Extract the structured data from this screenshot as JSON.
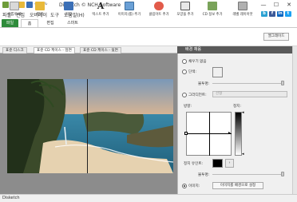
{
  "window": {
    "title": "Disketch © NCH Software",
    "minimize_glyph": "—",
    "maximize_glyph": "☐",
    "close_glyph": "✕"
  },
  "menubar": {
    "items": [
      "파일",
      "편집",
      "오버레이",
      "도구",
      "도움말(H)"
    ]
  },
  "social": [
    "b",
    "f",
    "in",
    "t"
  ],
  "ribbon_tabs": [
    "파일",
    "홈",
    "편집",
    "스마트"
  ],
  "toolbar": {
    "buttons": [
      {
        "label": "새롭게 새",
        "icon": "new-doc-icon",
        "color": "#d9d9d9"
      },
      {
        "label": "열기",
        "icon": "open-folder-icon",
        "color": "#e8b93a"
      },
      {
        "label": "저장",
        "icon": "save-icon",
        "color": "#3b6fb6"
      },
      {
        "label": "텍스트 추가",
        "icon": "text-icon",
        "color": "#ffffff"
      },
      {
        "label": "이미지(를) 추가",
        "icon": "add-image-icon",
        "color": "#6aa0d6"
      },
      {
        "label": "클립아트 추가",
        "icon": "clipart-icon",
        "color": "#e25b4a"
      },
      {
        "label": "모양을 추가",
        "icon": "shape-icon",
        "color": "#e8e8e8"
      },
      {
        "label": "CD 정보 추가",
        "icon": "cd-info-icon",
        "color": "#7aa35a"
      },
      {
        "label": "레벨 레이아웃",
        "icon": "layout-icon",
        "color": "#b0b0b0"
      }
    ],
    "help_label": "엘그레이드"
  },
  "doc_tabs": [
    "표준 디스크",
    "표준 CD 케이스 - 앞면",
    "표준 CD 케이스 - 뒷면"
  ],
  "panel": {
    "header": "배경 채움",
    "no_fill": "채우기 없음",
    "solid": "단색:",
    "opacity_label": "불투명:",
    "gradient": "그라디언트:",
    "gradient_select": "선형",
    "direction_label": "방향:",
    "stop_label": "정지:",
    "stop_color_label": "정지 유인트:",
    "opacity2_label": "불투명:",
    "image": "이미지:",
    "file_button": "이미지를 배경으로 설정",
    "solid_color": "#ffffff",
    "stop_color": "#000000"
  },
  "status": "Disketch"
}
